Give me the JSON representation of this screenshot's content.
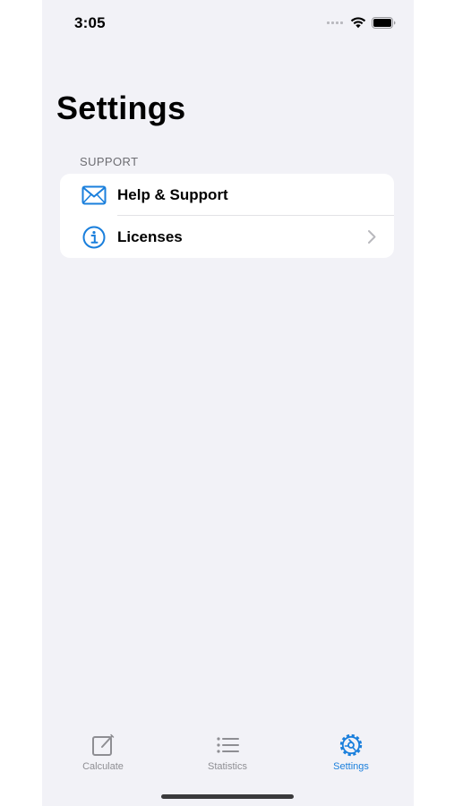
{
  "status_bar": {
    "time": "3:05"
  },
  "page": {
    "title": "Settings"
  },
  "section": {
    "header": "SUPPORT",
    "rows": [
      {
        "label": "Help & Support",
        "icon": "envelope-icon"
      },
      {
        "label": "Licenses",
        "icon": "info-circle-icon",
        "has_chevron": true
      }
    ]
  },
  "tab_bar": {
    "tabs": [
      {
        "label": "Calculate",
        "icon": "square-pencil-icon",
        "active": false
      },
      {
        "label": "Statistics",
        "icon": "list-bullet-icon",
        "active": false
      },
      {
        "label": "Settings",
        "icon": "gear-icon",
        "active": true
      }
    ]
  },
  "colors": {
    "accent": "#1a7fdc",
    "background": "#f2f2f7",
    "inactive_tab": "#8e8e93"
  }
}
